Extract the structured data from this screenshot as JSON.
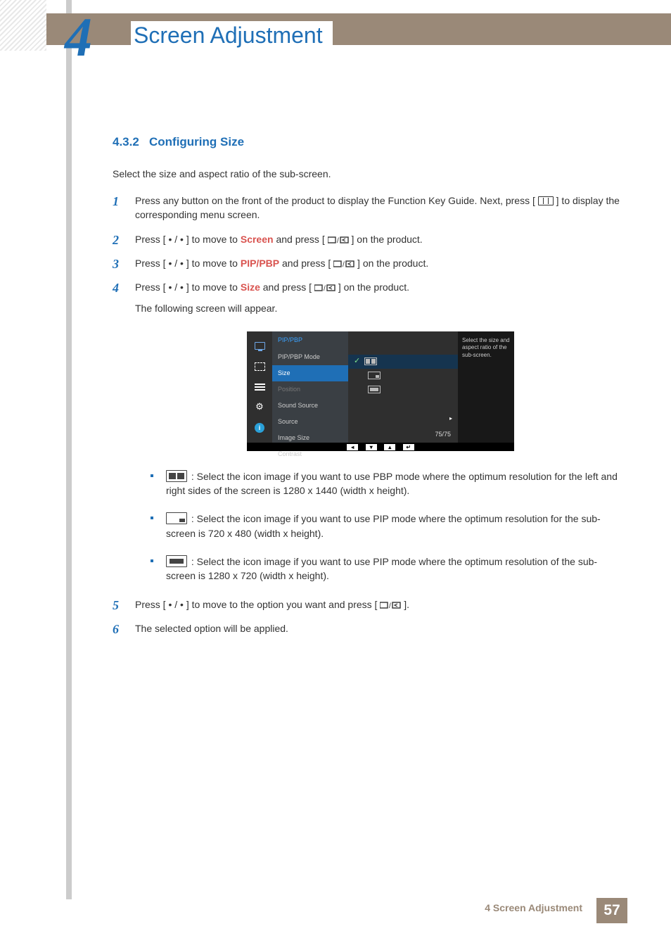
{
  "chapter": {
    "number": "4",
    "title": "Screen Adjustment"
  },
  "section": {
    "number": "4.3.2",
    "title": "Configuring Size"
  },
  "intro": "Select the size and aspect ratio of the sub-screen.",
  "steps": {
    "s1_a": "Press any button on the front of the product to display the Function Key Guide. Next, press [",
    "s1_b": "] to display the corresponding menu screen.",
    "s2_a": "Press [ • / • ] to move to ",
    "s2_kw": "Screen",
    "s2_b": " and press [",
    "s2_c": "] on the product.",
    "s3_a": "Press [ • / • ] to move to ",
    "s3_kw": "PIP/PBP",
    "s3_b": " and press [",
    "s3_c": "] on the product.",
    "s4_a": "Press [ • / • ] to move to ",
    "s4_kw": "Size",
    "s4_b": " and press [",
    "s4_c": "] on the product.",
    "s4_d": "The following screen will appear.",
    "b1": ": Select the icon image if you want to use PBP mode where the optimum resolution for the left and right sides of the screen is 1280 x 1440 (width x height).",
    "b2": ": Select the icon image if you want to use PIP mode where the optimum resolution for the sub-screen is 720 x 480 (width x height).",
    "b3": ": Select the icon image if you want to use PIP mode where the optimum resolution of the sub-screen is 1280 x 720 (width x height).",
    "s5_a": "Press [ • / • ] to move to the option you want and press [",
    "s5_b": "].",
    "s6": "The selected option will be applied."
  },
  "osd": {
    "breadcrumb": "PIP/PBP",
    "items": [
      "PIP/PBP Mode",
      "Size",
      "Position",
      "Sound Source",
      "Source",
      "Image Size",
      "Contrast"
    ],
    "contrast_value": "75/75",
    "help": "Select the size and aspect ratio of the sub-screen."
  },
  "footer": {
    "text": "4 Screen Adjustment",
    "page": "57"
  }
}
